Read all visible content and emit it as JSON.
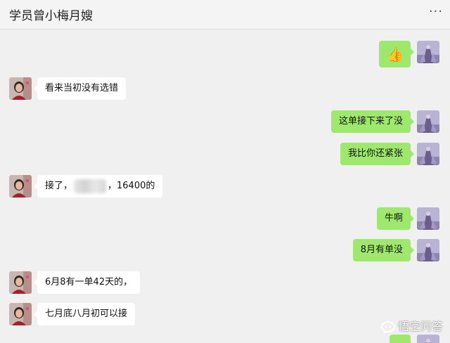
{
  "header": {
    "title": "学员曾小梅月嫂",
    "more": "···"
  },
  "messages": [
    {
      "side": "out",
      "text": "👍"
    },
    {
      "side": "in",
      "text": "看来当初没有选错"
    },
    {
      "side": "out",
      "text": "这单接下来了没"
    },
    {
      "side": "out",
      "text": "我比你还紧张"
    },
    {
      "side": "in",
      "text_before": "接了，",
      "text_after": "，16400的"
    },
    {
      "side": "out",
      "text": "牛啊"
    },
    {
      "side": "out",
      "text": "8月有单没"
    },
    {
      "side": "in",
      "text": "6月8有一单42天的，"
    },
    {
      "side": "in",
      "text": "七月底八月初可以接"
    }
  ],
  "watermark": {
    "text": "悟空问答"
  },
  "colors": {
    "outgoing_bubble": "#9fe86e",
    "incoming_bubble": "#ffffff",
    "background": "#f0f0f0"
  }
}
